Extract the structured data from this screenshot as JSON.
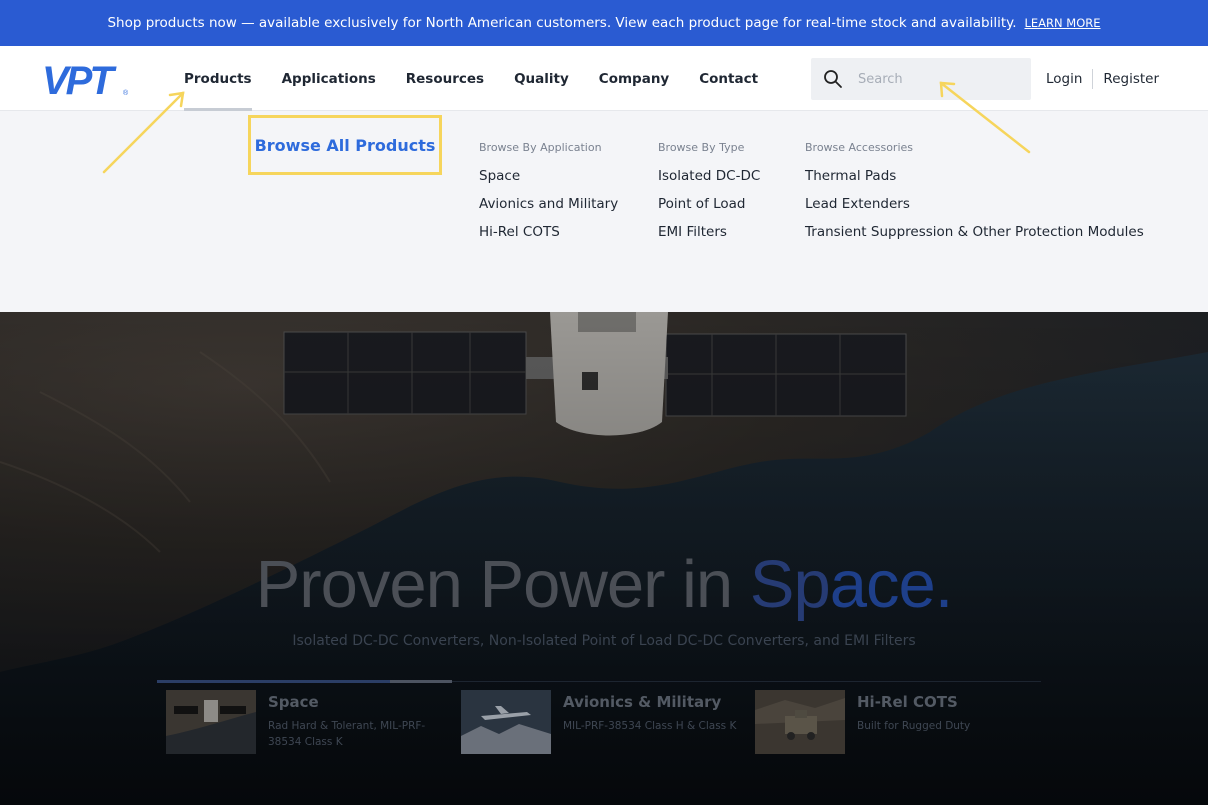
{
  "banner": {
    "text": "Shop products now — available exclusively for North American customers. View each product page for real-time stock and availability.",
    "link": "LEARN MORE"
  },
  "header": {
    "logo_text": "VPT",
    "nav": [
      "Products",
      "Applications",
      "Resources",
      "Quality",
      "Company",
      "Contact"
    ],
    "active_nav": "Products",
    "search_placeholder": "Search",
    "login": "Login",
    "register": "Register"
  },
  "dropdown": {
    "browse_all": "Browse All Products",
    "columns": [
      {
        "heading": "Browse By Application",
        "links": [
          "Space",
          "Avionics and Military",
          "Hi-Rel COTS"
        ]
      },
      {
        "heading": "Browse By Type",
        "links": [
          "Isolated DC-DC",
          "Point of Load",
          "EMI Filters"
        ]
      },
      {
        "heading": "Browse Accessories",
        "links": [
          "Thermal Pads",
          "Lead Extenders",
          "Transient Suppression & Other Protection Modules"
        ]
      }
    ]
  },
  "hero": {
    "title_main": "Proven Power in ",
    "title_accent1": "Sp",
    "title_accent2": "ace.",
    "subtitle": "Isolated DC-DC Converters, Non-Isolated Point of Load DC-DC Converters, and EMI Filters",
    "cards": [
      {
        "title": "Space",
        "desc": "Rad Hard & Tolerant, MIL-PRF-38534 Class K"
      },
      {
        "title": "Avionics & Military",
        "desc": "MIL-PRF-38534 Class H & Class K"
      },
      {
        "title": "Hi-Rel COTS",
        "desc": "Built for Rugged Duty"
      }
    ]
  },
  "colors": {
    "banner": "#2a5bd2",
    "accent": "#2e6bdc",
    "highlight": "#f6d55c"
  }
}
